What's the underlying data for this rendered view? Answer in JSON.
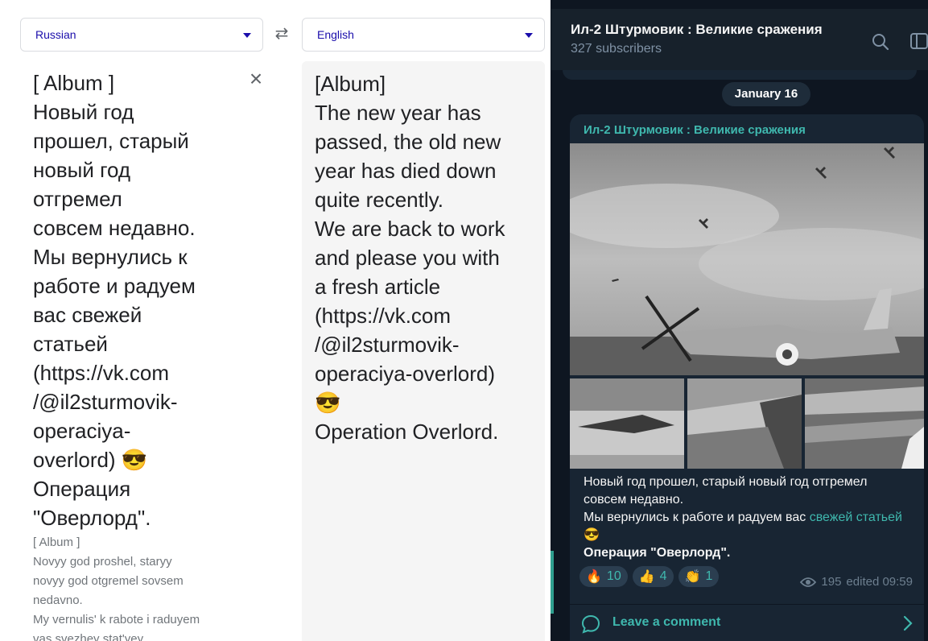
{
  "translate": {
    "source_language": "Russian",
    "target_language": "English",
    "source_text": "[ Album ]\nНовый год\nпрошел, старый\nновый год\nотгремел\nсовсем недавно.\nМы вернулись к\nработе и радуем\nвас свежей\nстатьей\n(https://vk.com\n/@il2sturmovik-\noperaciya-\noverlord)",
    "source_text_tail": "Операция\n\"Оверлорд\".",
    "transliteration": "[ Album ]\nNovyy god proshel, staryy\nnovyy god otgremel sovsem\nnedavno.\nMy vernulis' k rabote i raduyem\nvas svezhey stat'yey",
    "target_text": "[Album]\nThe new year has\npassed, the old new\nyear has died down\nquite recently.\nWe are back to work\nand please you with\na fresh article\n(https://vk.com\n/@il2sturmovik-\noperaciya-overlord)",
    "target_text_tail": "Operation Overlord.",
    "emoji": "😎"
  },
  "telegram": {
    "channel_title": "Ил-2 Штурмовик : Великие сражения",
    "subscribers": "327 subscribers",
    "date_label": "January 16",
    "author": "Ил-2 Штурмовик : Великие сражения",
    "message_line1": "Новый год прошел, старый новый год отгремел совсем недавно.",
    "message_line2_prefix": "Мы вернулись к работе и радуем вас ",
    "message_link": "свежей статьей",
    "message_emoji": "😎",
    "message_bold": "Операция \"Оверлорд\".",
    "reactions": [
      {
        "icon": "🔥",
        "count": "10"
      },
      {
        "icon": "👍",
        "count": "4"
      },
      {
        "icon": "👏",
        "count": "1"
      }
    ],
    "views": "195",
    "edited": "edited 09:59",
    "comment_label": "Leave a comment",
    "colors": {
      "accent": "#3fb8ae",
      "bubble": "#182533",
      "background": "#0e1621"
    }
  }
}
